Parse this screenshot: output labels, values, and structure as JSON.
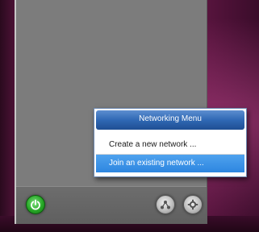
{
  "networking_menu": {
    "title": "Networking Menu",
    "items": [
      {
        "label": "Create a new network ..."
      },
      {
        "label": "Join an existing network ..."
      }
    ],
    "selected_index": 1
  },
  "panel_footer": {
    "power_button_icon": "power-icon",
    "network_button_icon": "network-icon",
    "settings_button_icon": "settings-icon"
  },
  "colors": {
    "menu_header": "#2f68b4",
    "menu_selected": "#2d86e0",
    "power_green": "#27a827",
    "panel_gray": "#7c7c7c"
  }
}
